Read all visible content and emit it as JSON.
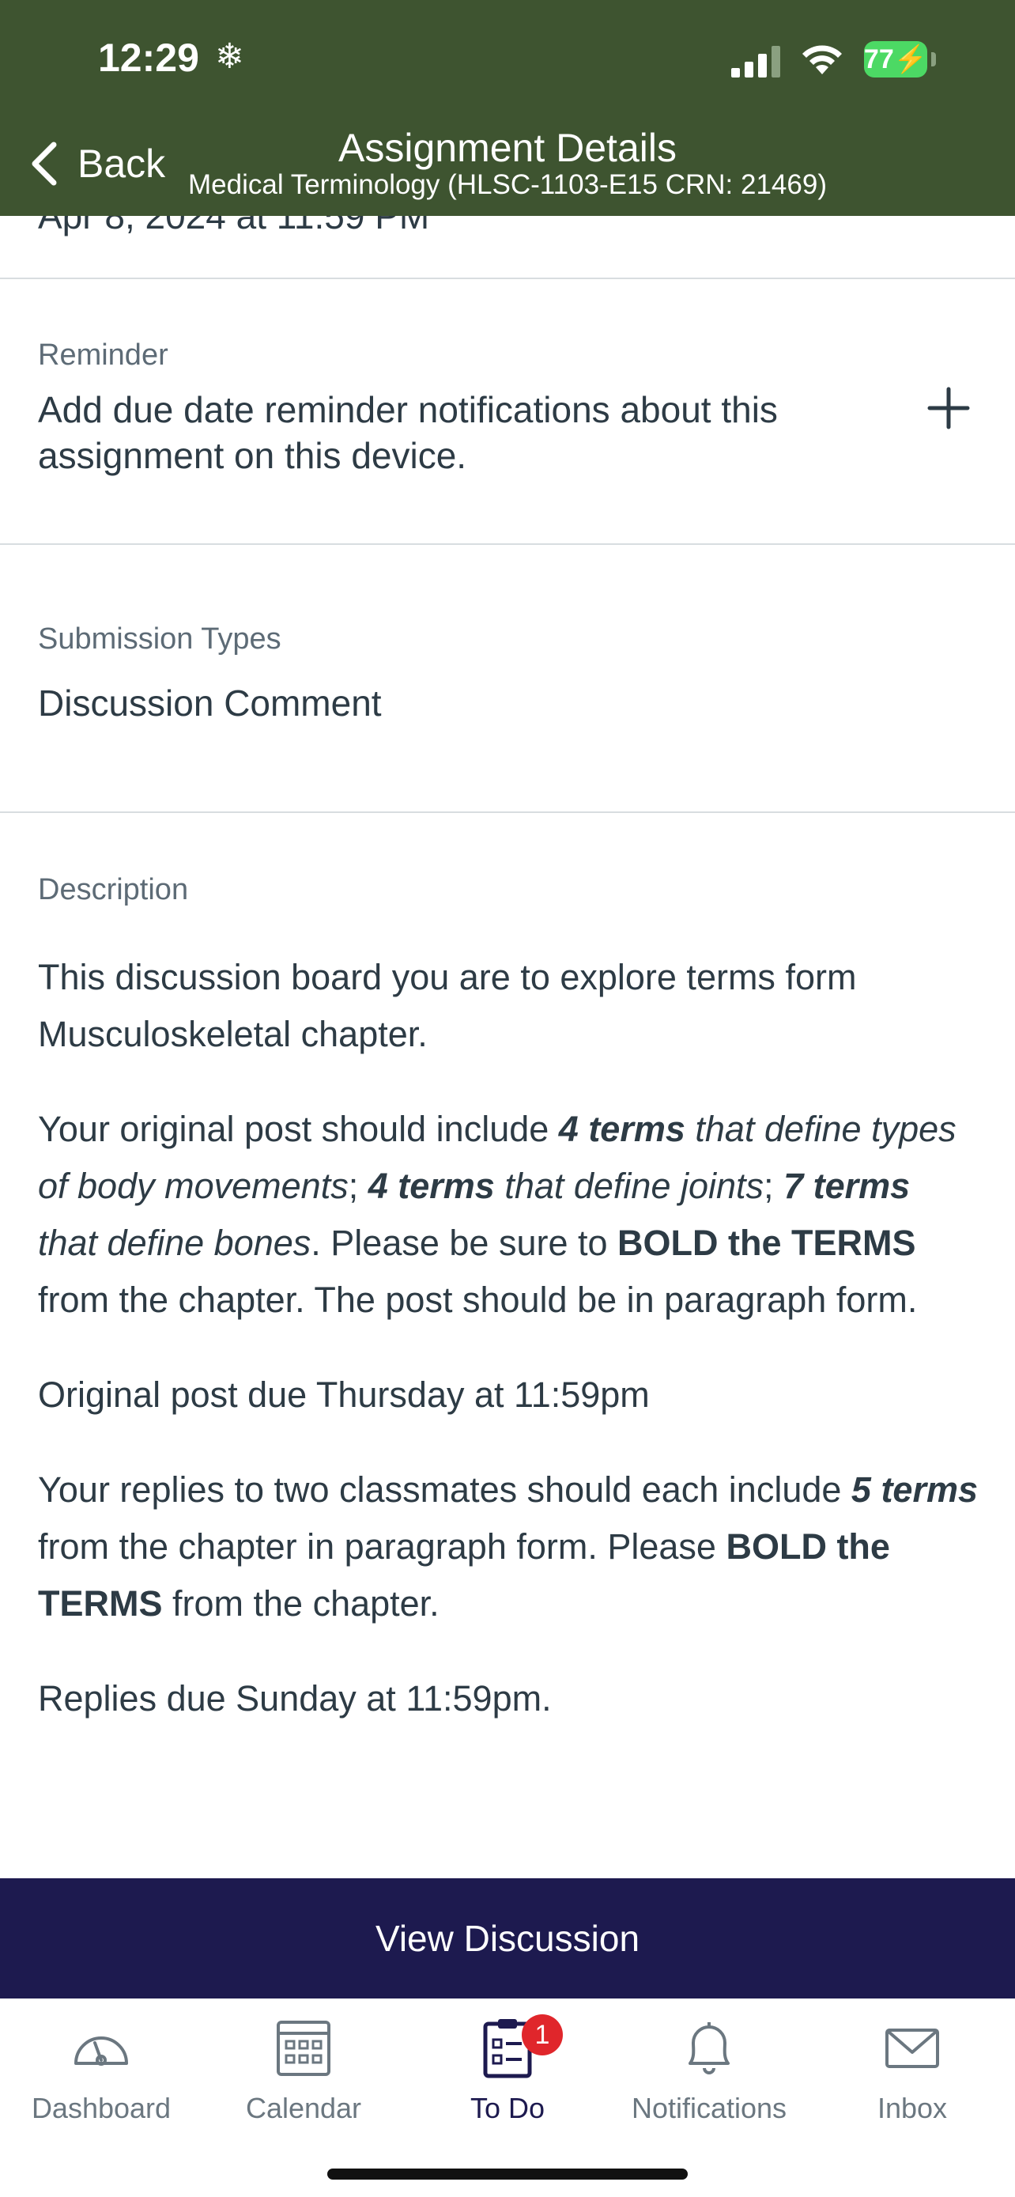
{
  "status_bar": {
    "time": "12:29",
    "battery": "77"
  },
  "header": {
    "back_label": "Back",
    "title": "Assignment Details",
    "subtitle": "Medical Terminology (HLSC-1103-E15 CRN: 21469)"
  },
  "due": {
    "clipped_text": "Apr 8, 2024 at 11:59 PM"
  },
  "reminder": {
    "label": "Reminder",
    "text": "Add due date reminder notifications about this assignment on this device."
  },
  "submission": {
    "label": "Submission Types",
    "value": "Discussion Comment"
  },
  "description": {
    "label": "Description",
    "p1": "This discussion board you are to explore terms form Musculoskeletal chapter.",
    "p2": {
      "a": "Your original post should include ",
      "b": "4 terms",
      "c": " that define types of body movements",
      "d": "; ",
      "e": "4 terms",
      "f": " that define joints",
      "g": "; ",
      "h": "7 terms",
      "i": " that define bones",
      "j": ".  Please be sure to ",
      "k": "BOLD the TERMS",
      "l": " from the chapter.  The post should be in paragraph form."
    },
    "p3": "Original post due Thursday at 11:59pm",
    "p4": {
      "a": "Your replies to two classmates should each include ",
      "b": "5 terms",
      "c": " from the chapter in paragraph form.  Please ",
      "d": "BOLD the TERMS",
      "e": " from the chapter."
    },
    "p5": "Replies due Sunday at 11:59pm."
  },
  "view_button": "View Discussion",
  "tabs": [
    {
      "label": "Dashboard",
      "icon": "dashboard-icon"
    },
    {
      "label": "Calendar",
      "icon": "calendar-icon"
    },
    {
      "label": "To Do",
      "icon": "todo-icon",
      "badge": "1",
      "active": true
    },
    {
      "label": "Notifications",
      "icon": "bell-icon"
    },
    {
      "label": "Inbox",
      "icon": "mail-icon"
    }
  ],
  "colors": {
    "header_bg": "#3e5430",
    "button_bg": "#1d1a4f",
    "badge": "#e0262b"
  }
}
